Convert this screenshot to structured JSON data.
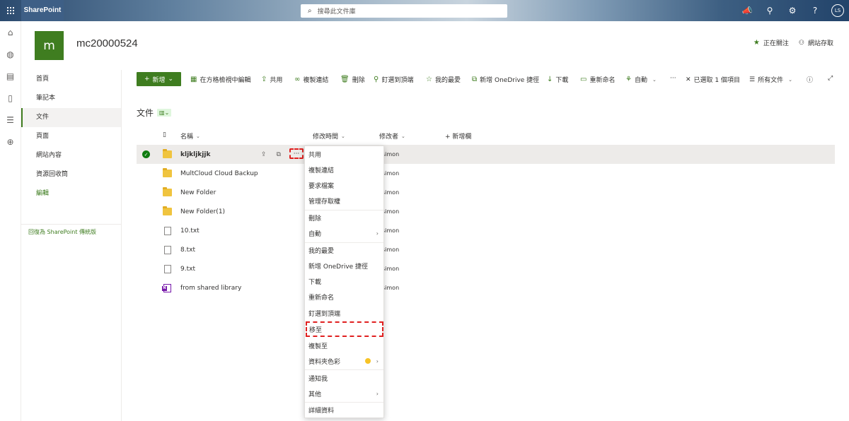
{
  "suite": {
    "brand": "SharePoint",
    "search_placeholder": "搜尋此文件庫",
    "avatar": "LS"
  },
  "site": {
    "logo_letter": "m",
    "title": "mc20000524",
    "following": "正在關注",
    "site_access": "網站存取"
  },
  "nav": {
    "items": [
      "首頁",
      "筆記本",
      "文件",
      "頁面",
      "網站內容",
      "資源回收筒"
    ],
    "edit": "編輯",
    "return_classic": "回復為 SharePoint 傳統版"
  },
  "toolbar": {
    "new": "新增",
    "grid_edit": "在方格檢視中編輯",
    "share": "共用",
    "copy_link": "複製連結",
    "delete": "刪除",
    "pin_top": "釘選到頂端",
    "favorite": "我的最愛",
    "add_onedrive": "新增 OneDrive 捷徑",
    "download": "下載",
    "rename": "重新命名",
    "automate": "自動",
    "more": "···",
    "selected": "已選取 1 個項目",
    "all_docs": "所有文件"
  },
  "library": {
    "title": "文件"
  },
  "columns": {
    "name": "名稱",
    "modified": "修改時間",
    "modified_by": "修改者",
    "add_column": "+ 新增欄"
  },
  "rows": [
    {
      "name": "kljkljkjjk",
      "type": "folder",
      "by": "simon"
    },
    {
      "name": "MultCloud Cloud Backup",
      "type": "folder",
      "by": "simon"
    },
    {
      "name": "New Folder",
      "type": "folder",
      "by": "simon"
    },
    {
      "name": "New Folder(1)",
      "type": "folder",
      "by": "simon"
    },
    {
      "name": "10.txt",
      "type": "txt",
      "by": "simon"
    },
    {
      "name": "8.txt",
      "type": "txt",
      "by": "simon"
    },
    {
      "name": "9.txt",
      "type": "txt",
      "by": "simon"
    },
    {
      "name": "from shared library",
      "type": "onenote",
      "by": "simon"
    }
  ],
  "context_menu": {
    "items": [
      "共用",
      "複製連結",
      "要求檔案",
      "管理存取權",
      "刪除",
      "自動",
      "我的最愛",
      "新增 OneDrive 捷徑",
      "下載",
      "重新命名",
      "釘選到頂端",
      "移至",
      "複製至",
      "資料夾色彩",
      "通知我",
      "其他",
      "詳細資料"
    ]
  },
  "colors": {
    "accent": "#3f7d20",
    "highlight_dash": "#e02020",
    "folder": "#f0c43f",
    "folder_color_dot": "#f7c326"
  }
}
